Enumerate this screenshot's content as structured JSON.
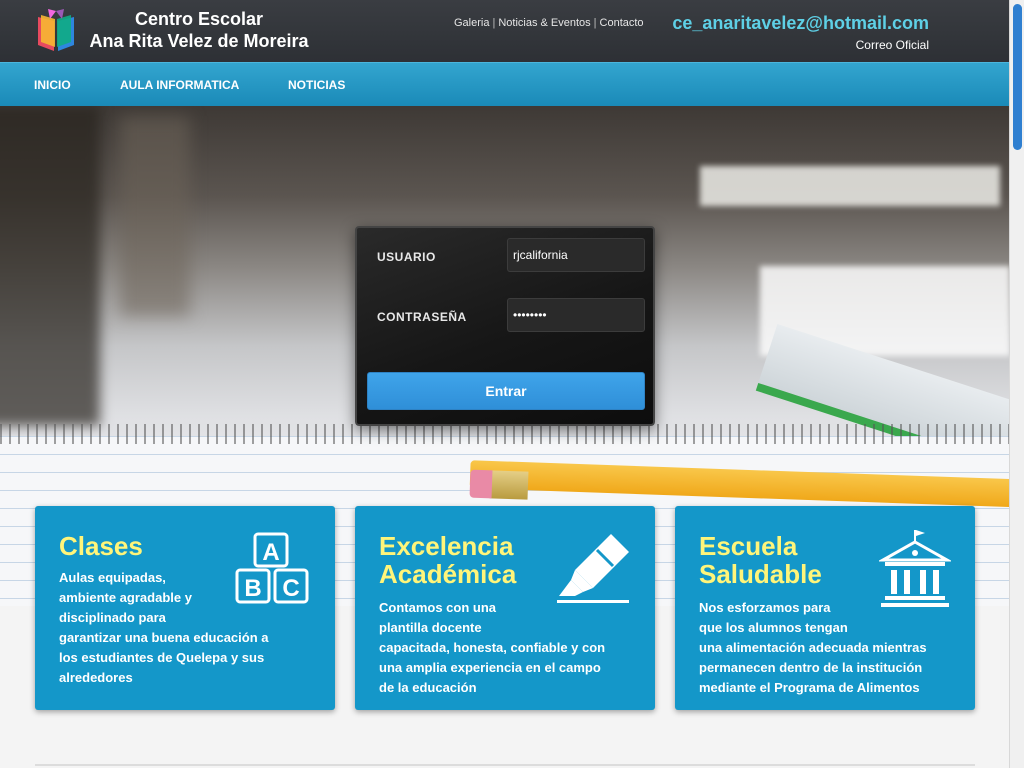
{
  "header": {
    "school_line1": "Centro Escolar",
    "school_line2": "Ana Rita Velez de Moreira",
    "links": [
      "Galeria",
      "Noticias & Eventos",
      "Contacto"
    ],
    "link_separator": "|",
    "email": "ce_anaritavelez@hotmail.com",
    "email_label": "Correo Oficial",
    "logo_icon": "open-book-icon"
  },
  "nav": {
    "items": [
      "INICIO",
      "AULA INFORMATICA",
      "NOTICIAS"
    ]
  },
  "login": {
    "user_label": "USUARIO",
    "user_value": "rjcalifornia",
    "password_label": "CONTRASEÑA",
    "password_value": "••••••••",
    "submit_label": "Entrar"
  },
  "cards": [
    {
      "title_lines": [
        "Clases"
      ],
      "text_lines": [
        "Aulas equipadas,",
        "ambiente agradable y",
        "disciplinado para",
        "garantizar una buena educación a",
        "los estudiantes de Quelepa y sus",
        "alrededores"
      ],
      "icon": "abc-blocks-icon"
    },
    {
      "title_lines": [
        "Excelencia",
        "Académica"
      ],
      "text_lines": [
        "Contamos con una",
        "plantilla docente",
        "capacitada, honesta, confiable y con",
        "una amplia experiencia en el campo",
        "de la educación"
      ],
      "icon": "highlighter-icon"
    },
    {
      "title_lines": [
        "Escuela",
        "Saludable"
      ],
      "text_lines": [
        "Nos esforzamos para",
        "que los alumnos tengan",
        "una alimentación adecuada mientras",
        "permanecen dentro de la institución",
        "mediante el Programa de Alimentos"
      ],
      "icon": "school-building-icon"
    }
  ],
  "colors": {
    "header_bg": "#2d3035",
    "nav_bg": "#1a8ab8",
    "email": "#5ed0e6",
    "card_bg": "#1497c9",
    "card_title": "#fff57a",
    "button": "#3fa4ea"
  }
}
